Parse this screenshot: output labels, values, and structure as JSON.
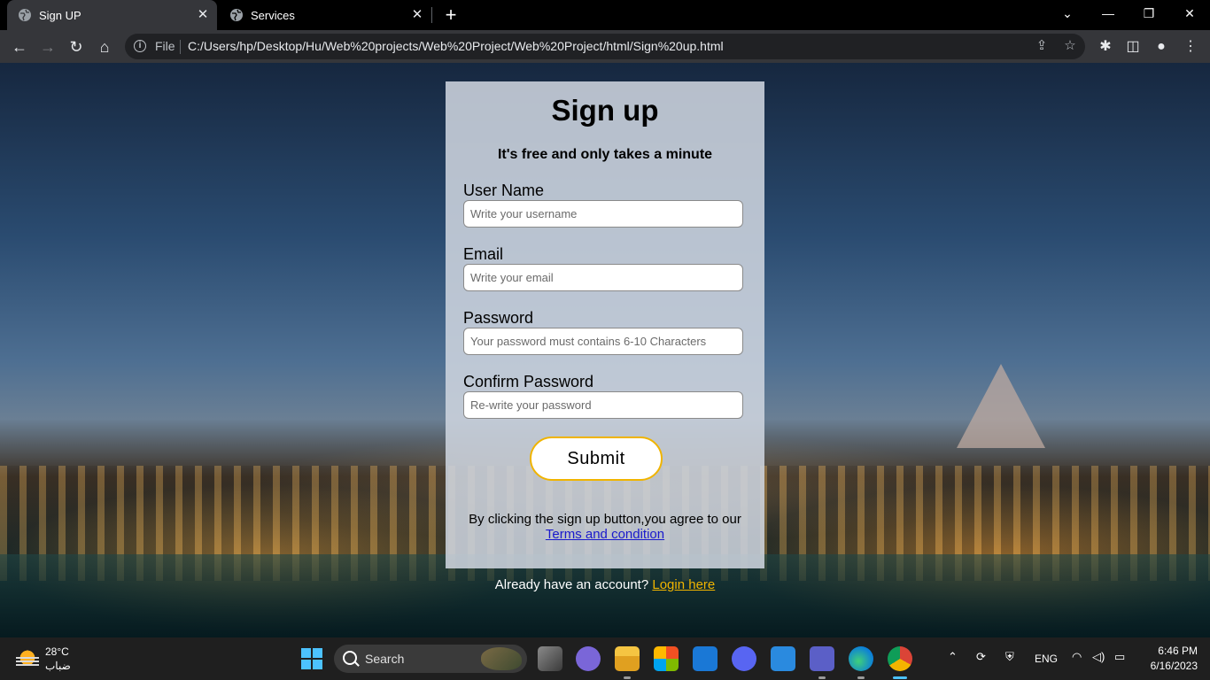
{
  "browser": {
    "tabs": [
      {
        "title": "Sign UP",
        "active": true
      },
      {
        "title": "Services",
        "active": false
      }
    ],
    "new_tab_label": "+",
    "address": {
      "scheme_label": "File",
      "url": "C:/Users/hp/Desktop/Hu/Web%20projects/Web%20Project/Web%20Project/html/Sign%20up.html"
    }
  },
  "form": {
    "title": "Sign up",
    "subtitle": "It's free and only takes a minute",
    "fields": [
      {
        "label": "User Name",
        "placeholder": "Write your username",
        "value": ""
      },
      {
        "label": "Email",
        "placeholder": "Write your email",
        "value": ""
      },
      {
        "label": "Password",
        "placeholder": "Your password must contains 6-10 Characters",
        "value": ""
      },
      {
        "label": "Confirm Password",
        "placeholder": "Re-write your password",
        "value": ""
      }
    ],
    "submit_label": "Submit",
    "agree_text": "By clicking the sign up button,you agree to our",
    "terms_link": "Terms and condition",
    "already_text": "Already have an account?",
    "login_link": "Login here"
  },
  "taskbar": {
    "weather": {
      "temp": "28°C",
      "condition": "ضباب"
    },
    "search_label": "Search",
    "tray": {
      "language": "ENG"
    },
    "clock": {
      "time": "6:46 PM",
      "date": "6/16/2023"
    }
  },
  "colors": {
    "accent": "#f0b400",
    "link": "#1a1acc",
    "card_bg": "#cdd4de"
  }
}
